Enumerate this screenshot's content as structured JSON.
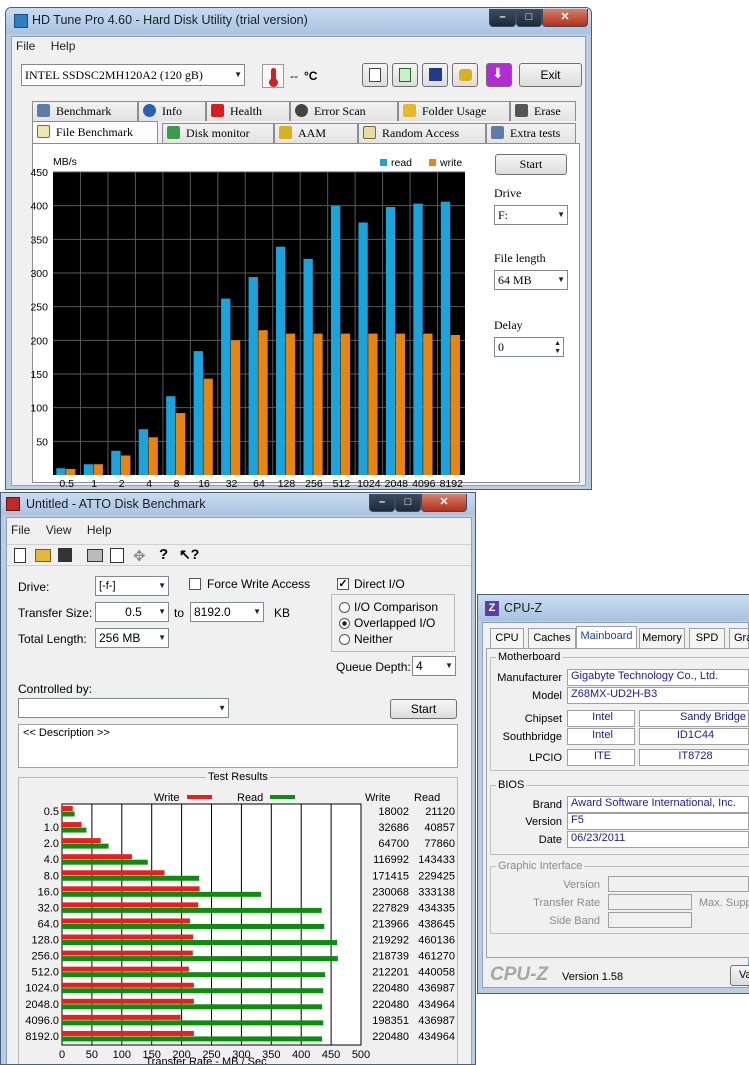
{
  "hdtune": {
    "title": "HD Tune Pro 4.60 - Hard Disk Utility (trial version)",
    "menu": [
      "File",
      "Help"
    ],
    "drive": "INTEL SSDSC2MH120A2 (120 gB)",
    "temp": "--",
    "temp_unit": "°C",
    "exit_label": "Exit",
    "tabs_row1": [
      "Benchmark",
      "Info",
      "Health",
      "Error Scan",
      "Folder Usage",
      "Erase"
    ],
    "tabs_row2": [
      "File Benchmark",
      "Disk monitor",
      "AAM",
      "Random Access",
      "Extra tests"
    ],
    "start_label": "Start",
    "drive_label": "Drive",
    "drive_value": "F:",
    "file_length_label": "File length",
    "file_length_value": "64 MB",
    "delay_label": "Delay",
    "delay_value": "0",
    "legend": {
      "read": "read",
      "write": "write"
    },
    "colors": {
      "read": "#1aa3dc",
      "write": "#e9840f"
    }
  },
  "chart_data": [
    {
      "type": "bar",
      "ylabel": "MB/s",
      "ylim": [
        0,
        450
      ],
      "yticks": [
        50,
        100,
        150,
        200,
        250,
        300,
        350,
        400,
        450
      ],
      "categories": [
        "0.5",
        "1",
        "2",
        "4",
        "8",
        "16",
        "32",
        "64",
        "128",
        "256",
        "512",
        "1024",
        "2048",
        "4096",
        "8192"
      ],
      "series": [
        {
          "name": "read",
          "values": [
            10,
            16,
            36,
            68,
            117,
            184,
            262,
            294,
            339,
            321,
            400,
            375,
            398,
            403,
            406
          ]
        },
        {
          "name": "write",
          "values": [
            9,
            16,
            29,
            56,
            92,
            143,
            200,
            215,
            210,
            210,
            210,
            210,
            210,
            210,
            208
          ]
        }
      ],
      "grid": true,
      "legend_position": "top-right"
    },
    {
      "type": "bar",
      "title": "Test Results",
      "xlabel": "Transfer Rate - MB / Sec",
      "xlim": [
        0,
        500
      ],
      "xticks": [
        0,
        50,
        100,
        150,
        200,
        250,
        300,
        350,
        400,
        450,
        500
      ],
      "categories": [
        "0.5",
        "1.0",
        "2.0",
        "4.0",
        "8.0",
        "16.0",
        "32.0",
        "64.0",
        "128.0",
        "256.0",
        "512.0",
        "1024.0",
        "2048.0",
        "4096.0",
        "8192.0"
      ],
      "series": [
        {
          "name": "Write",
          "values": [
            18002,
            32686,
            64700,
            116992,
            171415,
            230068,
            227829,
            213966,
            219292,
            218739,
            212201,
            220480,
            220480,
            198351,
            220480
          ]
        },
        {
          "name": "Read",
          "values": [
            21120,
            40857,
            77860,
            143433,
            229425,
            333138,
            434335,
            438645,
            460136,
            461270,
            440058,
            436987,
            434964,
            436987,
            434964
          ]
        }
      ],
      "column_headers": [
        "Write",
        "Read"
      ],
      "grid": true,
      "legend_position": "top"
    }
  ],
  "atto": {
    "title": "Untitled - ATTO Disk Benchmark",
    "menu": [
      "File",
      "View",
      "Help"
    ],
    "drive_label": "Drive:",
    "drive_value": "[-f-]",
    "force_write_label": "Force Write Access",
    "direct_io_label": "Direct I/O",
    "transfer_size_label": "Transfer Size:",
    "transfer_from": "0.5",
    "to_label": "to",
    "transfer_to": "8192.0",
    "kb_label": "KB",
    "total_length_label": "Total Length:",
    "total_length_value": "256 MB",
    "io_comparison_label": "I/O Comparison",
    "overlapped_io_label": "Overlapped I/O",
    "neither_label": "Neither",
    "queue_depth_label": "Queue Depth:",
    "queue_depth_value": "4",
    "controlled_by_label": "Controlled by:",
    "start_label": "Start",
    "description": "<< Description >>",
    "colors": {
      "write": "#ee1c1c",
      "read": "#0a8f0a"
    }
  },
  "cpuz": {
    "title": "CPU-Z",
    "tabs": [
      "CPU",
      "Caches",
      "Mainboard",
      "Memory",
      "SPD",
      "Gra"
    ],
    "motherboard_group": "Motherboard",
    "manufacturer_label": "Manufacturer",
    "manufacturer": "Gigabyte Technology Co., Ltd.",
    "model_label": "Model",
    "model": "Z68MX-UD2H-B3",
    "chipset_label": "Chipset",
    "chipset_vendor": "Intel",
    "chipset_name": "Sandy Bridge",
    "southbridge_label": "Southbridge",
    "southbridge_vendor": "Intel",
    "southbridge_name": "ID1C44",
    "lpcio_label": "LPCIO",
    "lpcio_vendor": "ITE",
    "lpcio_name": "IT8728",
    "bios_group": "BIOS",
    "brand_label": "Brand",
    "brand": "Award Software International, Inc.",
    "version_label": "Version",
    "version": "F5",
    "date_label": "Date",
    "date": "06/23/2011",
    "graphic_group": "Graphic Interface",
    "gi_version_label": "Version",
    "gi_transfer_label": "Transfer Rate",
    "gi_max_label": "Max. Supp",
    "gi_sideband_label": "Side Band",
    "logo": "CPU-Z",
    "app_version": "Version 1.58",
    "validate": "Va"
  }
}
